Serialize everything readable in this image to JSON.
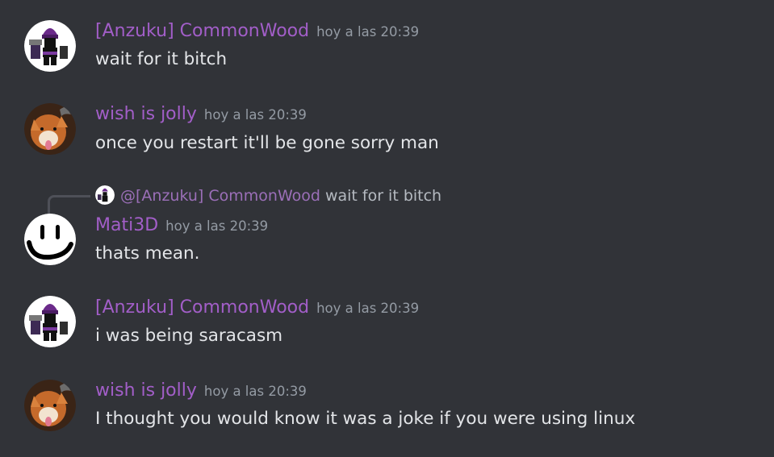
{
  "messages": [
    {
      "username": "[Anzuku] CommonWood",
      "timestamp": "hoy a las 20:39",
      "content": "wait for it bitch",
      "avatar_icon": "purple-beanie-character-avatar"
    },
    {
      "username": "wish is jolly",
      "timestamp": "hoy a las 20:39",
      "content": "once you restart it'll be gone sorry man",
      "avatar_icon": "fox-with-bat-avatar"
    },
    {
      "username": "Mati3D",
      "timestamp": "hoy a las 20:39",
      "content": "thats mean.",
      "avatar_icon": "smiley-face-avatar",
      "reply": {
        "mention": "@[Anzuku] CommonWood",
        "text": "wait for it bitch"
      }
    },
    {
      "username": "[Anzuku] CommonWood",
      "timestamp": "hoy a las 20:39",
      "content": "i was being saracasm",
      "avatar_icon": "purple-beanie-character-avatar"
    },
    {
      "username": "wish is jolly",
      "timestamp": "hoy a las 20:39",
      "content": "I thought you would know it was a joke if you were using linux",
      "avatar_icon": "fox-with-bat-avatar"
    }
  ],
  "colors": {
    "background": "#313338",
    "username": "#a25ec8",
    "timestamp": "#949ba4",
    "message_text": "#e3e5e8",
    "mention": "#9b6fb8"
  }
}
